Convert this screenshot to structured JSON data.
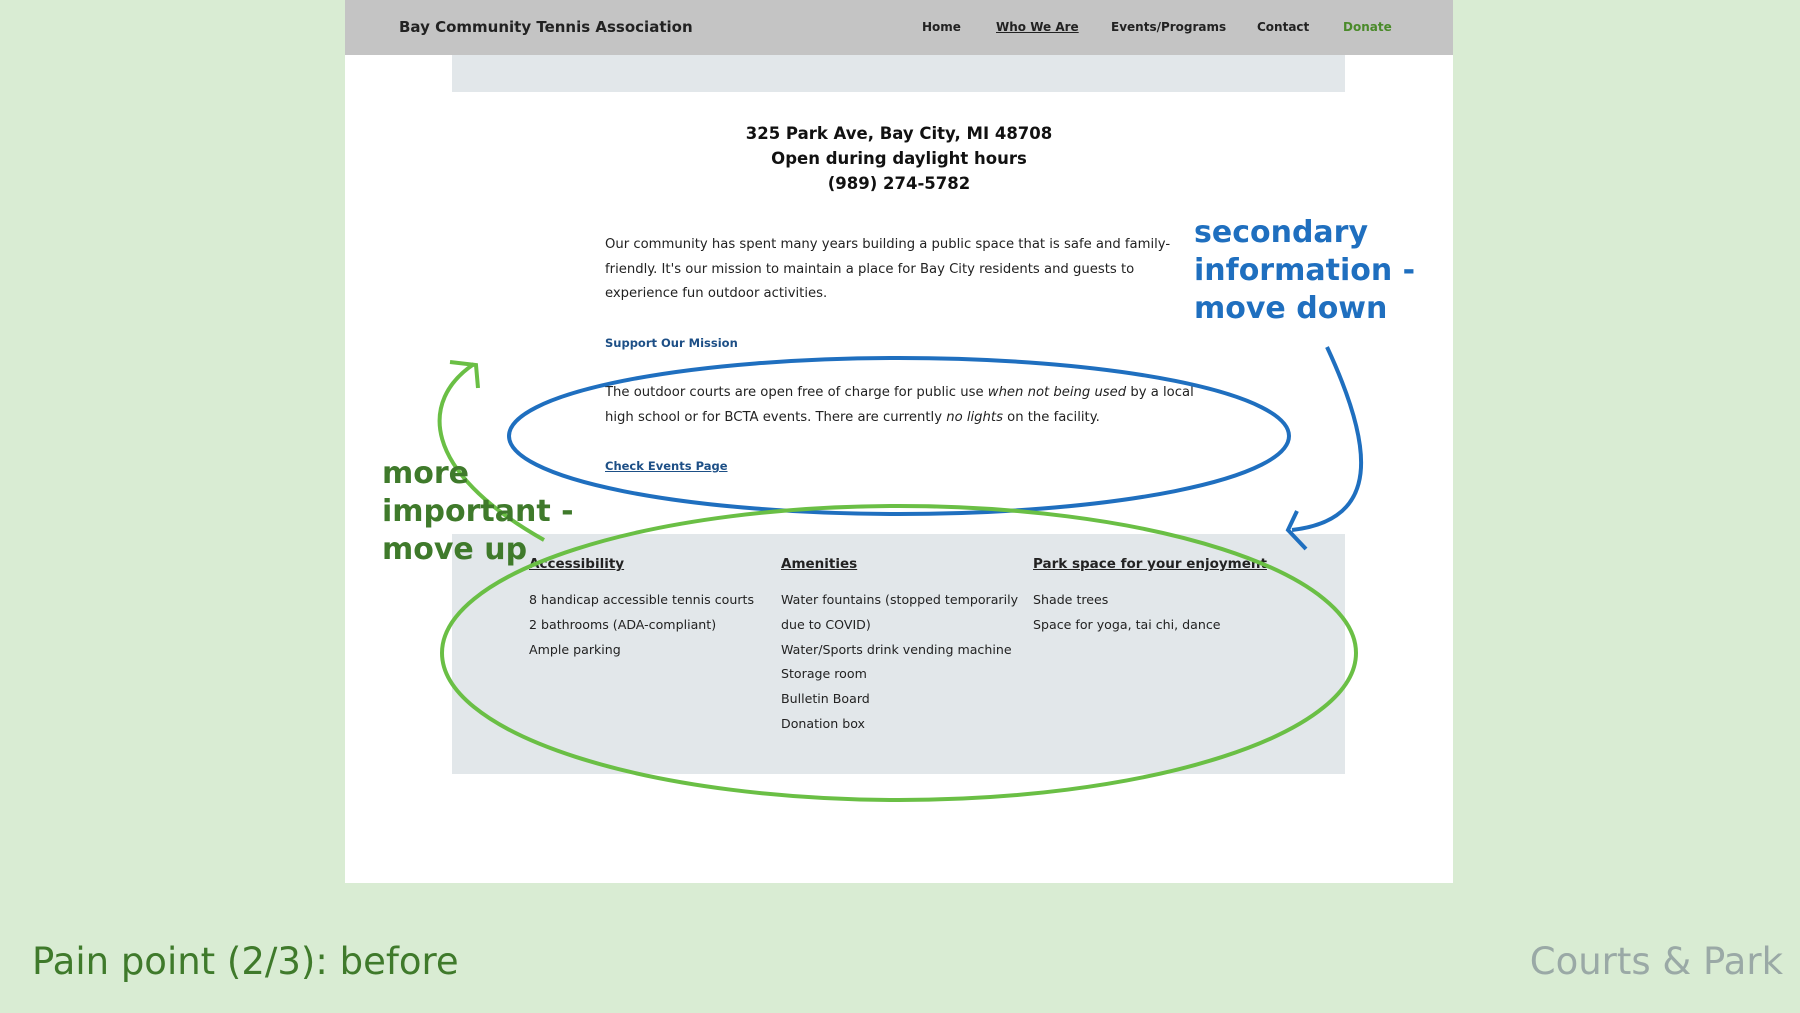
{
  "nav": {
    "brand": "Bay Community Tennis Association",
    "links": [
      "Home",
      "Who We Are",
      "Events/Programs",
      "Contact",
      "Donate"
    ]
  },
  "info": {
    "address": "325 Park Ave, Bay City, MI 48708",
    "hours": "Open during daylight hours",
    "phone": "(989) 274-5782"
  },
  "mission": {
    "text": "Our community has spent many years building a public space that is safe and family-friendly. It's our mission to maintain a place for Bay City residents and guests to experience fun outdoor activities.",
    "link": "Support Our Mission"
  },
  "courts": {
    "t1": "The outdoor courts are open free of charge for public use ",
    "em1": "when not being used",
    "t2": " by a local high school or for BCTA events.  There are currently ",
    "em2": "no lights",
    "t3": " on the facility.",
    "link": "Check Events Page"
  },
  "columns": [
    {
      "title": "Accessibility",
      "items": [
        "8 handicap accessible tennis courts",
        "2 bathrooms (ADA-compliant)",
        "Ample parking"
      ]
    },
    {
      "title": "Amenities",
      "items": [
        "Water fountains (stopped temporarily due to COVID)",
        "Water/Sports drink vending machine",
        "Storage room",
        "Bulletin Board",
        "Donation box"
      ]
    },
    {
      "title": "Park space for your enjoyment",
      "items": [
        "Shade trees",
        "Space for yoga, tai chi, dance"
      ]
    }
  ],
  "annotations": {
    "secondary": [
      "secondary",
      "information -",
      "move down"
    ],
    "important": [
      "more",
      "important -",
      "move up"
    ]
  },
  "footer": {
    "left": "Pain point (2/3): before",
    "right": "Courts & Park"
  },
  "colors": {
    "blue": "#1f6fbf",
    "green": "#6abf45",
    "darkgreen": "#3f7a2b"
  }
}
